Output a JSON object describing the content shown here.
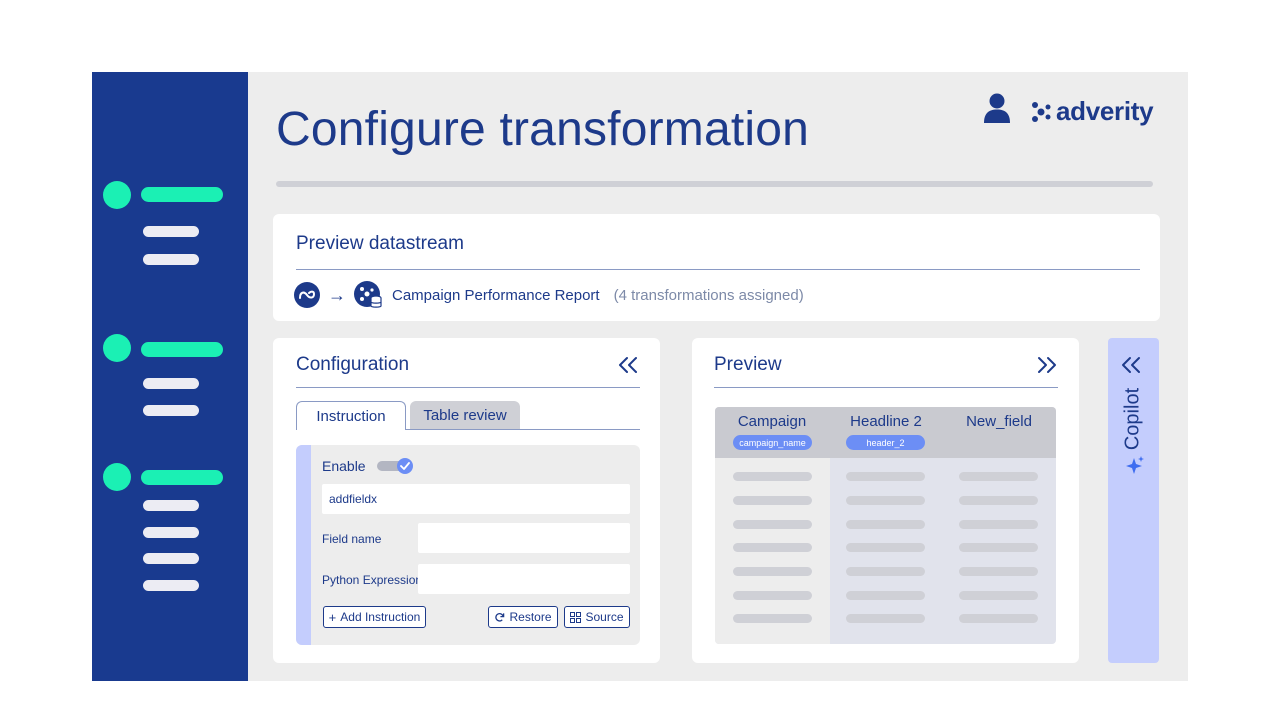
{
  "page": {
    "title": "Configure transformation"
  },
  "brand": {
    "name": "adverity"
  },
  "datastream": {
    "heading": "Preview datastream",
    "name": "Campaign Performance Report",
    "count": "(4 transformations assigned)"
  },
  "configuration": {
    "heading": "Configuration",
    "tabs": [
      {
        "label": "Instruction",
        "active": true
      },
      {
        "label": "Table review",
        "active": false
      }
    ],
    "instruction": {
      "enable_label": "Enable",
      "enabled": true,
      "value": "addfieldx",
      "field_name_label": "Field name",
      "field_name_value": "",
      "python_expression_label": "Python Expression",
      "python_expression_value": ""
    },
    "buttons": {
      "add_instruction": "Add Instruction",
      "restore": "Restore",
      "source": "Source"
    }
  },
  "preview": {
    "heading": "Preview",
    "columns": [
      {
        "header": "Campaign",
        "field": "campaign_name"
      },
      {
        "header": "Headline 2",
        "field": "header_2"
      },
      {
        "header": "New_field",
        "field": ""
      }
    ]
  },
  "copilot": {
    "label": "Copilot"
  },
  "colors": {
    "navy": "#1d3a8a",
    "sidebar": "#193a8f",
    "accent_green": "#1bf0b4",
    "pill_blue": "#6c8ef5",
    "copilot_bg": "#c4cdfd"
  }
}
